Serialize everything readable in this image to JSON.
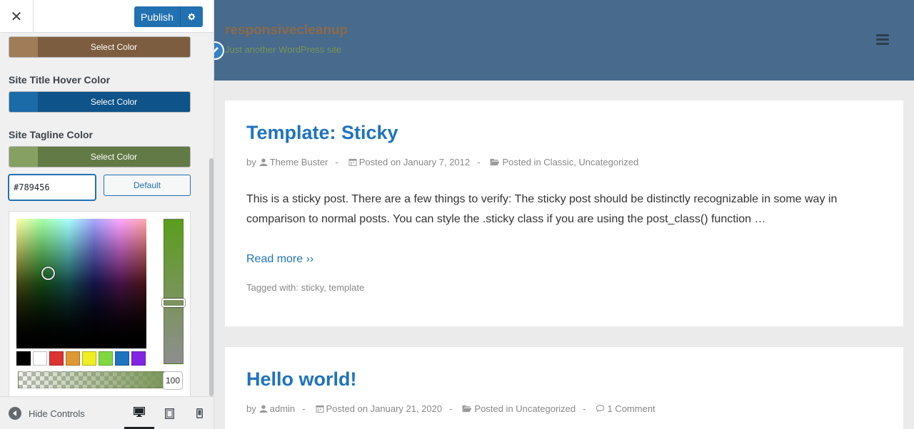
{
  "sidebar": {
    "close_label": "✕",
    "publish_label": "Publish",
    "controls": {
      "site_title_color": {
        "button_label": "Select Color",
        "color": "#8b6a4a"
      },
      "site_title_hover_color": {
        "title": "Site Title Hover Color",
        "button_label": "Select Color",
        "color": "#0e5389"
      },
      "site_tagline_color": {
        "title": "Site Tagline Color",
        "button_label": "Select Color",
        "color": "#789456"
      }
    },
    "color_picker": {
      "hex_value": "#789456",
      "default_label": "Default",
      "alpha_value": "100",
      "palette": [
        "#000000",
        "#ffffff",
        "#dd3333",
        "#dd9933",
        "#eeee22",
        "#81d742",
        "#1e73be",
        "#8224e3"
      ]
    },
    "footer": {
      "hide_controls_label": "Hide Controls"
    }
  },
  "preview": {
    "site_title": "responsivecleanup",
    "site_tagline": "Just another WordPress site",
    "header_color": "#476a8d",
    "posts": [
      {
        "title": "Template: Sticky",
        "by": "by",
        "author": "Theme Buster",
        "posted_on": "Posted on January 7, 2012",
        "posted_in": "Posted in",
        "categories": "Classic, Uncategorized",
        "excerpt": "This is a sticky post. There are a few things to verify: The sticky post should be distinctly recognizable in some way in comparison to normal posts. You can style the .sticky class if you are using the post_class() function …",
        "read_more": "Read more ››",
        "tagged_with": "Tagged with:",
        "tags": "sticky, template"
      },
      {
        "title": "Hello world!",
        "by": "by",
        "author": "admin",
        "posted_on": "Posted on January 21, 2020",
        "posted_in": "Posted in",
        "categories": "Uncategorized",
        "comments": "1 Comment"
      }
    ]
  }
}
